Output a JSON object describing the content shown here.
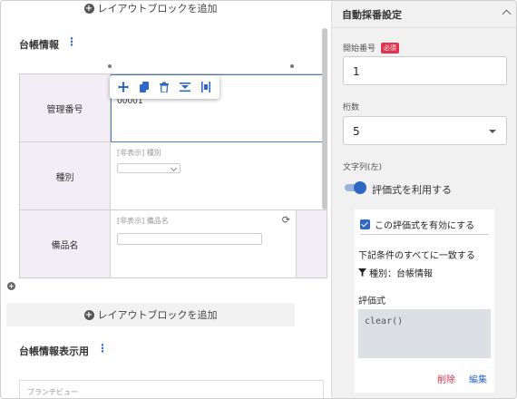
{
  "editor": {
    "add_block_label": "レイアウトブロックを追加",
    "section1_title": "台帳情報",
    "section2_title": "台帳情報表示用",
    "branch_label": "ブランチビュー",
    "rows": [
      {
        "label": "管理番号",
        "value": "00001"
      },
      {
        "label": "種別",
        "hidden_label": "[非表示] 種別"
      },
      {
        "label": "備品名",
        "hidden_label": "[非表示] 備品名"
      }
    ]
  },
  "panel": {
    "title": "自動採番設定",
    "start_number_label": "開始番号",
    "required_badge": "必須",
    "start_number_value": "1",
    "digits_label": "桁数",
    "digits_value": "5",
    "string_label": "文字列(左)",
    "use_expression_label": "評価式を利用する",
    "use_expression_on": true,
    "enable_expression_label": "この評価式を有効にする",
    "enable_expression_checked": true,
    "condition_text": "下記条件のすべてに一致する",
    "filter_text": "種別：台帳情報",
    "expression_label": "評価式",
    "expression_value": "clear()",
    "delete_label": "削除",
    "edit_label": "編集"
  },
  "colors": {
    "accent": "#2e67c4",
    "danger": "#e0334f",
    "label_cell_bg": "#f3eef5",
    "panel_bg": "#f1f1f1"
  },
  "icons": [
    "plus-circle-icon",
    "kebab-icon",
    "move-icon",
    "copy-icon",
    "trash-icon",
    "insert-row-icon",
    "insert-column-icon",
    "refresh-icon",
    "chevron-up-icon",
    "chevron-down-icon",
    "filter-icon",
    "checkbox-icon"
  ]
}
